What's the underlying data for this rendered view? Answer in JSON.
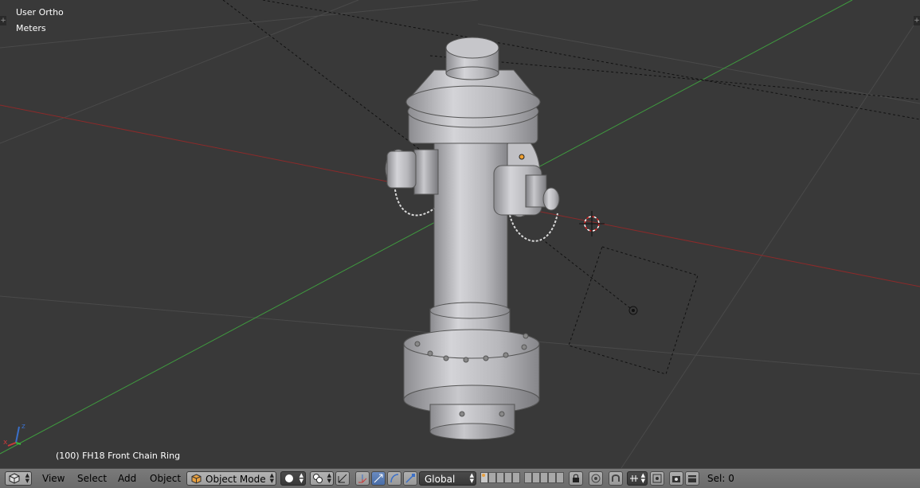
{
  "viewport": {
    "view_name": "User Ortho",
    "units": "Meters",
    "active_object": "(100) FH18 Front Chain Ring",
    "region_toggle_icon": "plus-icon"
  },
  "header": {
    "editor_type_icon": "cube-editor-icon",
    "menus": [
      "View",
      "Select",
      "Add",
      "Object"
    ],
    "mode": "Object Mode",
    "viewport_shading_icon": "solid-sphere-icon",
    "pivot_icon": "pivot-point-icon",
    "manipulator_icons": [
      "manipulator-toggle-icon",
      "translate-icon",
      "rotate-icon",
      "scale-icon"
    ],
    "orientation": "Global",
    "layers_icon": "layer-grid-icon",
    "lock_icon": "lock-camera-icon",
    "proportional_icon": "proportional-edit-icon",
    "snap_icons": [
      "snap-toggle-icon",
      "snap-element-icon",
      "snap-target-icon"
    ],
    "render_icons": [
      "opengl-render-icon",
      "opengl-animation-icon"
    ],
    "selection_count": "Sel: 0"
  },
  "colors": {
    "background": "#393939",
    "header": "#727272",
    "x_axis": "#8c2a2a",
    "y_axis": "#3f9a3f",
    "text": "#ffffff"
  }
}
